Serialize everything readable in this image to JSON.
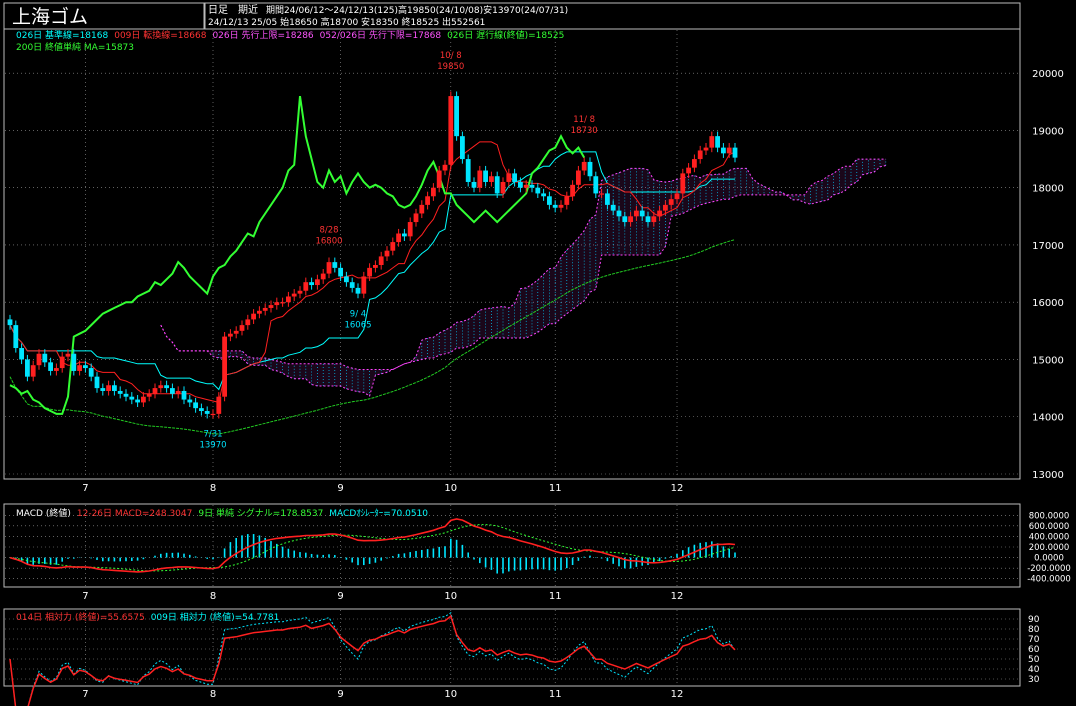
{
  "header": {
    "title": "上海ゴム",
    "timeframe": "日足",
    "contract": "期近",
    "period_line": "期間24/06/12～24/12/13(125)高19850(24/10/08)安13970(24/07/31)",
    "quote_line": "24/12/13 25/05 始18650 高18700 安18350 終18525 出552561"
  },
  "legend_main": {
    "line1": [
      {
        "text": "026日 基準線=18168",
        "color": "#00ffff"
      },
      {
        "text": "009日 転換線=18668",
        "color": "#ff3333"
      },
      {
        "text": "026日 先行上限=18286",
        "color": "#ff55ff"
      },
      {
        "text": "052/026日 先行下限=17868",
        "color": "#ff55ff"
      },
      {
        "text": "026日 遅行線(終値)=18525",
        "color": "#33ff33"
      }
    ],
    "line2": [
      {
        "text": "200日 終値単純 MA=15873",
        "color": "#33ff33"
      }
    ]
  },
  "legend_macd": [
    {
      "text": "MACD (終値)",
      "color": "#ffffff"
    },
    {
      "text": "12-26日 MACD=248.3047",
      "color": "#ff3333"
    },
    {
      "text": "9日 単純 シグナル=178.8537",
      "color": "#33ff33"
    },
    {
      "text": "MACDｵｼﾚｰﾀｰ=70.0510",
      "color": "#00ffff"
    }
  ],
  "legend_rsi": [
    {
      "text": "014日 相対力 (終値)=55.6575",
      "color": "#ff3333"
    },
    {
      "text": "009日 相対力 (終値)=54.7781",
      "color": "#00ffff"
    }
  ],
  "colors": {
    "up": "#ff2020",
    "down": "#00e5ff",
    "kijun": "#00ffff",
    "tenkan": "#ff2020",
    "span": "#ff44ff",
    "chikou": "#33ff33",
    "ma200": "#22cc22",
    "grid": "#9a9a9a"
  },
  "chart_data": [
    {
      "type": "candlestick",
      "title": "上海ゴム",
      "ylim": [
        13000,
        20300
      ],
      "y_ticks": [
        "20000",
        "19000",
        "18000",
        "17000",
        "16000",
        "15000",
        "14000",
        "13000"
      ],
      "x_month_labels": [
        {
          "label": "7",
          "index": 13
        },
        {
          "label": "8",
          "index": 35
        },
        {
          "label": "9",
          "index": 57
        },
        {
          "label": "10",
          "index": 76
        },
        {
          "label": "11",
          "index": 94
        },
        {
          "label": "12",
          "index": 115
        }
      ],
      "annotations": [
        {
          "label": "7/31\n13970",
          "index": 35,
          "price": 13970,
          "pos": "below",
          "color": "#00e5ff"
        },
        {
          "label": "8/28\n16800",
          "index": 55,
          "price": 16800,
          "pos": "above",
          "color": "#ff3333"
        },
        {
          "label": "9/ 4\n16065",
          "index": 60,
          "price": 16065,
          "pos": "below",
          "color": "#00e5ff"
        },
        {
          "label": "10/ 8\n19850",
          "index": 76,
          "price": 19850,
          "pos": "above",
          "color": "#ff3333"
        },
        {
          "label": "11/ 8\n18730",
          "index": 99,
          "price": 18730,
          "pos": "above",
          "color": "#ff3333"
        }
      ],
      "closes": [
        15600,
        15200,
        15000,
        14700,
        14900,
        15100,
        14950,
        14800,
        14850,
        15050,
        15100,
        14800,
        14900,
        14850,
        14700,
        14500,
        14450,
        14550,
        14450,
        14400,
        14350,
        14300,
        14250,
        14350,
        14400,
        14500,
        14550,
        14500,
        14400,
        14450,
        14300,
        14250,
        14150,
        14100,
        14050,
        14050,
        14350,
        15400,
        15450,
        15500,
        15600,
        15700,
        15800,
        15850,
        15900,
        15950,
        16000,
        16000,
        16100,
        16150,
        16200,
        16350,
        16300,
        16400,
        16500,
        16700,
        16600,
        16450,
        16350,
        16250,
        16150,
        16450,
        16600,
        16650,
        16800,
        16900,
        17050,
        17200,
        17150,
        17400,
        17550,
        17700,
        17850,
        18000,
        18300,
        18400,
        19600,
        18900,
        18500,
        18100,
        18000,
        18300,
        18100,
        18200,
        17900,
        18100,
        18250,
        18100,
        18000,
        18050,
        18000,
        17900,
        17850,
        17700,
        17650,
        17700,
        17850,
        18050,
        18300,
        18450,
        18200,
        17900,
        17900,
        17700,
        17600,
        17500,
        17400,
        17500,
        17600,
        17500,
        17400,
        17500,
        17600,
        17700,
        17800,
        17900,
        18250,
        18350,
        18500,
        18650,
        18700,
        18900,
        18700,
        18600,
        18700,
        18525
      ]
    },
    {
      "type": "line",
      "title": "MACD (終値)",
      "ylim": [
        -500,
        900
      ],
      "y_ticks": [
        "800.0000",
        "600.0000",
        "400.0000",
        "200.0000",
        "0.0000",
        "-200.0000",
        "-400.0000"
      ]
    },
    {
      "type": "line",
      "title": "相対力 (終値)",
      "ylim": [
        25,
        95
      ],
      "y_ticks": [
        "90",
        "80",
        "70",
        "60",
        "50",
        "40",
        "30"
      ]
    }
  ]
}
